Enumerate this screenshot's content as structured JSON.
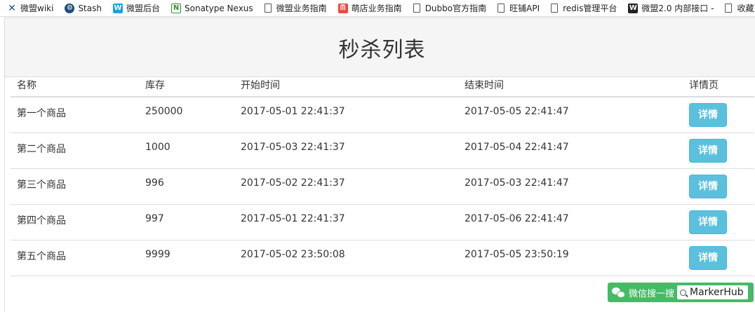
{
  "bookmarks": [
    {
      "label": "微盟wiki",
      "icon": "x-logo-icon"
    },
    {
      "label": "Stash",
      "icon": "stash-icon"
    },
    {
      "label": "微盟后台",
      "icon": "w-logo-icon"
    },
    {
      "label": "Sonatype Nexus",
      "icon": "nexus-icon"
    },
    {
      "label": "微盟业务指南",
      "icon": "page-icon"
    },
    {
      "label": "萌店业务指南",
      "icon": "shop-icon"
    },
    {
      "label": "Dubbo官方指南",
      "icon": "page-icon"
    },
    {
      "label": "旺铺API",
      "icon": "page-icon"
    },
    {
      "label": "redis管理平台",
      "icon": "page-icon"
    },
    {
      "label": "微盟2.0 内部接口 -",
      "icon": "w-dark-icon"
    },
    {
      "label": "收藏到",
      "icon": "page-icon"
    }
  ],
  "panel": {
    "title": "秒杀列表"
  },
  "table": {
    "headers": [
      "名称",
      "库存",
      "开始时间",
      "结束时间",
      "详情页"
    ],
    "rows": [
      {
        "name": "第一个商品",
        "stock": "250000",
        "start": "2017-05-01 22:41:37",
        "end": "2017-05-05 22:41:47",
        "action": "详情"
      },
      {
        "name": "第二个商品",
        "stock": "1000",
        "start": "2017-05-03 22:41:37",
        "end": "2017-05-04 22:41:47",
        "action": "详情"
      },
      {
        "name": "第三个商品",
        "stock": "996",
        "start": "2017-05-02 22:41:37",
        "end": "2017-05-03 22:41:47",
        "action": "详情"
      },
      {
        "name": "第四个商品",
        "stock": "997",
        "start": "2017-05-01 22:41:37",
        "end": "2017-05-06 22:41:47",
        "action": "详情"
      },
      {
        "name": "第五个商品",
        "stock": "9999",
        "start": "2017-05-02 23:50:08",
        "end": "2017-05-05 23:50:19",
        "action": "详情"
      }
    ]
  },
  "watermark": {
    "prefix": "微信搜一搜",
    "account": "MarkerHub"
  },
  "colors": {
    "button": "#5bc0de",
    "heading_bg": "#f5f5f5",
    "watermark": "#44bb66"
  }
}
